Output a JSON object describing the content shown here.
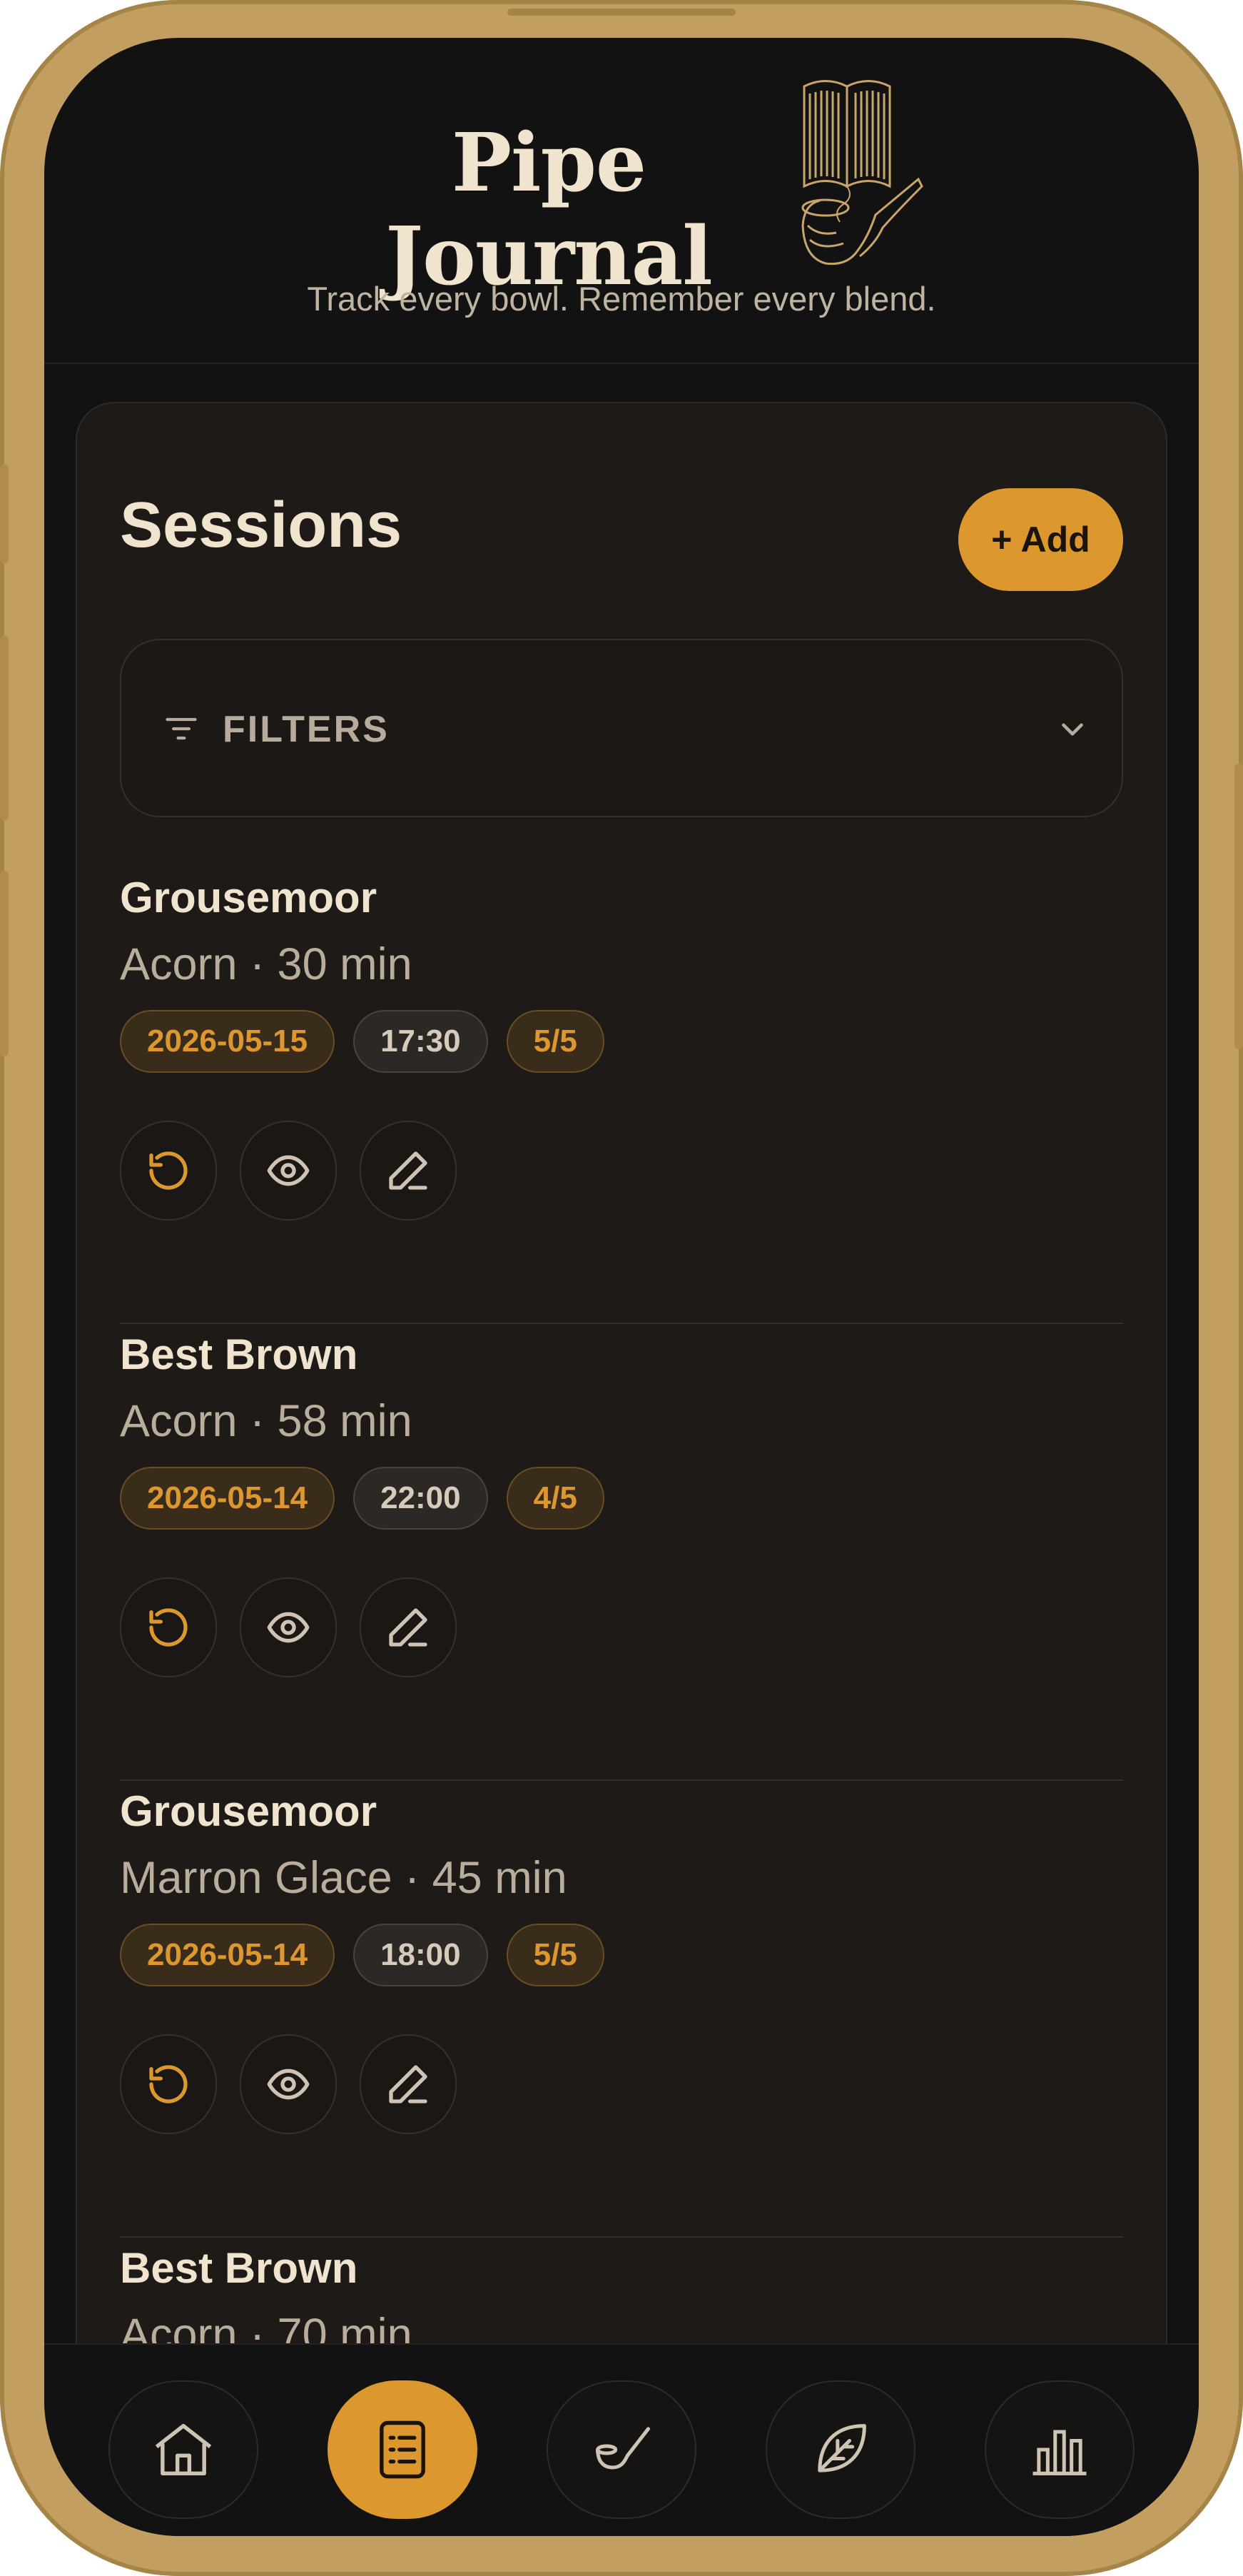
{
  "app": {
    "title": "Pipe Journal",
    "tagline": "Track every bowl. Remember every blend."
  },
  "sessions_panel": {
    "title": "Sessions",
    "add_label": "+ Add",
    "filters_label": "FILTERS"
  },
  "sessions": [
    {
      "blend": "Grousemoor",
      "subtitle": "Acorn · 30 min",
      "date": "2026-05-15",
      "time": "17:30",
      "rating": "5/5"
    },
    {
      "blend": "Best Brown",
      "subtitle": "Acorn · 58 min",
      "date": "2026-05-14",
      "time": "22:00",
      "rating": "4/5"
    },
    {
      "blend": "Grousemoor",
      "subtitle": "Marron Glace · 45 min",
      "date": "2026-05-14",
      "time": "18:00",
      "rating": "5/5"
    },
    {
      "blend": "Best Brown",
      "subtitle": "Acorn · 70 min",
      "date": "",
      "time": "",
      "rating": ""
    }
  ],
  "actions": [
    "repeat-icon",
    "view-icon",
    "edit-icon"
  ],
  "nav": [
    {
      "icon": "home-icon",
      "active": false
    },
    {
      "icon": "list-icon",
      "active": true
    },
    {
      "icon": "pipe-icon",
      "active": false
    },
    {
      "icon": "leaf-icon",
      "active": false
    },
    {
      "icon": "chart-icon",
      "active": false
    }
  ],
  "colors": {
    "accent": "#dc972e",
    "background": "#121212",
    "card": "#1e1a18",
    "frame": "#c29f61",
    "text_primary": "#f1e4cf",
    "text_secondary": "#b9ad9c"
  }
}
